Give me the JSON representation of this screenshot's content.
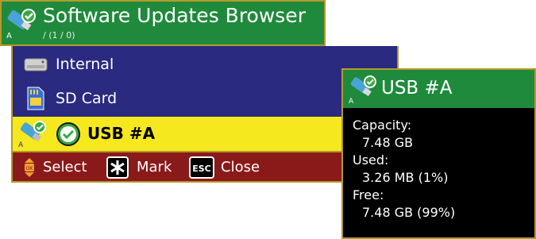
{
  "header": {
    "title": "Software Updates Browser",
    "path": "/  (1 / 0)",
    "icon": "usb-drive-check-icon"
  },
  "list": {
    "items": [
      {
        "label": "Internal",
        "icon": "hard-drive-icon"
      },
      {
        "label": "SD Card",
        "icon": "sd-card-icon"
      },
      {
        "label": "USB #A",
        "icon": "usb-drive-icon",
        "status_icon": "check-circle-icon",
        "selected": true
      }
    ]
  },
  "footer": {
    "select_label": "Select",
    "mark_label": "Mark",
    "close_label": "Close",
    "ok_key": "OK",
    "esc_key": "ESC"
  },
  "details": {
    "title": "USB #A",
    "capacity_label": "Capacity:",
    "capacity_value": "7.48 GB",
    "used_label": "Used:",
    "used_value": "3.26 MB (1%)",
    "free_label": "Free:",
    "free_value": "7.48 GB (99%)"
  },
  "colors": {
    "header_green": "#1f8a3c",
    "list_blue": "#2a2a80",
    "selection_yellow": "#f5e81e",
    "footer_red": "#8a1a1a",
    "border_gold": "#b39a2a"
  }
}
